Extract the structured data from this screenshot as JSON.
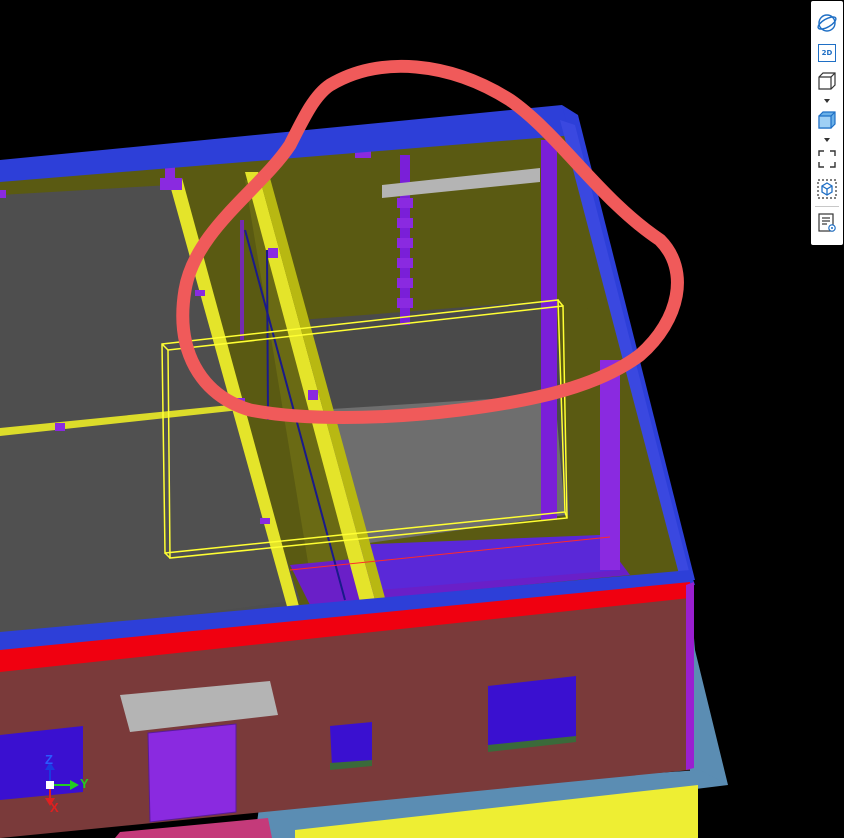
{
  "toolbar": {
    "view_2d_label": "2D"
  },
  "axes": {
    "z_label": "Z",
    "y_label": "Y",
    "x_label": "X"
  },
  "colors": {
    "background": "#000000",
    "toolbar_accent": "#1f6fc5",
    "annotation_circle": "#f05a5a",
    "selection_box": "#ffff33"
  },
  "icons": [
    "orbit-icon",
    "view-2d-icon",
    "wireframe-cube-icon",
    "shaded-cube-icon",
    "fit-view-icon",
    "section-box-icon",
    "properties-list-icon"
  ]
}
